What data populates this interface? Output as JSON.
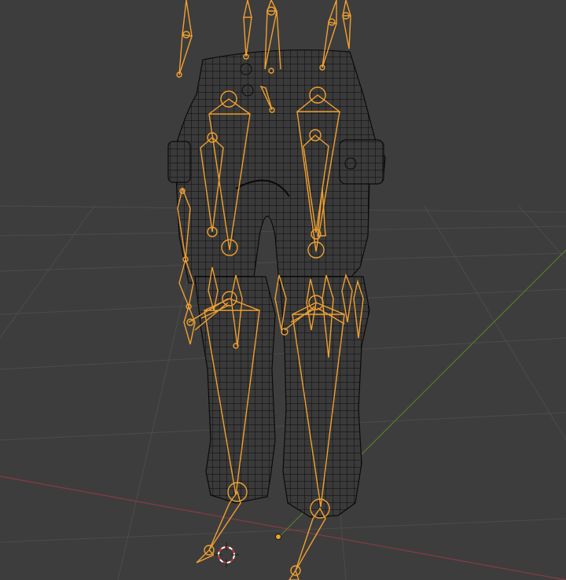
{
  "viewport": {
    "background": "#3d3d3d",
    "grid_color": "#4a4a4a",
    "x_axis_color": "#8a3a45",
    "y_axis_color": "#5a7a2a",
    "wire_color": "#0a0a0a",
    "armature_color": "#f0a030",
    "origin_color": "#f0a030",
    "cursor_colors": [
      "#ffffff",
      "#d33030"
    ]
  },
  "scene": {
    "objects": [
      {
        "name": "pants-mesh",
        "display": "wireframe",
        "type": "mesh"
      },
      {
        "name": "armature",
        "display": "octahedral-bones",
        "type": "armature",
        "selected": true
      }
    ],
    "widgets": [
      "3d-cursor-icon",
      "object-origin-icon"
    ]
  }
}
